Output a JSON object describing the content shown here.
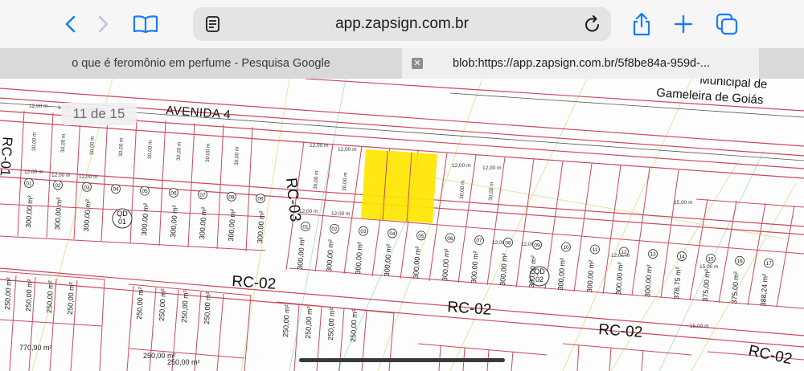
{
  "browser": {
    "url": "app.zapsign.com.br",
    "tabs": [
      {
        "title": "o que é feromônio em perfume - Pesquisa Google",
        "active": false
      },
      {
        "title": "blob:https://app.zapsign.com.br/5f8be84a-959d-...",
        "active": true
      }
    ],
    "accent_color": "#1a7cf5",
    "icons": {
      "back": "chevron-left-icon",
      "forward": "chevron-right-icon",
      "bookmarks": "book-icon",
      "reader": "reader-icon",
      "reload": "reload-icon",
      "share": "share-icon",
      "new_tab": "plus-icon",
      "tabs": "tabs-icon"
    }
  },
  "viewer": {
    "page_indicator": "11 de 15"
  },
  "map": {
    "street_labels": {
      "avenida": "AVENIDA 4",
      "rc01": "RC-01",
      "rc03": "RC-03",
      "rc02_a": "RC-02",
      "rc02_b": "RC-02",
      "rc02_c": "RC-02",
      "rc02_d": "RC-02"
    },
    "municipality": [
      "Municipal de",
      "Gameleira de Goiás"
    ],
    "blocks": {
      "qd01": [
        "QD",
        "01"
      ],
      "qd02": [
        "QD",
        "02"
      ]
    },
    "highlight_color": "#ffe600",
    "lot_dims": {
      "frontage": "12,00 m",
      "depth": "30,00 m",
      "side": "15,00 m"
    },
    "upper_lots": [
      {
        "num": "01",
        "area": "300,00 m²"
      },
      {
        "num": "02",
        "area": "300,00 m²"
      },
      {
        "num": "03",
        "area": "300,00 m²"
      },
      {
        "num": "04",
        "area": "300,00 m²"
      },
      {
        "num": "05",
        "area": "300,00 m²"
      },
      {
        "num": "06",
        "area": "300,00 m²"
      },
      {
        "num": "07",
        "area": "300,00 m²"
      },
      {
        "num": "08",
        "area": "300,00 m²"
      },
      {
        "num": "09",
        "area": "300,00 m²"
      }
    ],
    "mid_lots": [
      {
        "num": "01",
        "area": "300,00 m²"
      },
      {
        "num": "02",
        "area": "300,00 m²"
      },
      {
        "num": "03",
        "area": "300,00 m²"
      },
      {
        "num": "04",
        "area": "300,00 m²"
      },
      {
        "num": "05",
        "area": "300,00 m²"
      },
      {
        "num": "06",
        "area": "300,00 m²"
      },
      {
        "num": "07",
        "area": "300,00 m²"
      },
      {
        "num": "08",
        "area": "300,00 m²"
      },
      {
        "num": "09",
        "area": "300,00 m²"
      },
      {
        "num": "10",
        "area": "300,00 m²"
      },
      {
        "num": "11",
        "area": "300,00 m²"
      },
      {
        "num": "12",
        "area": "300,00 m²"
      },
      {
        "num": "13",
        "area": "300,00 m²"
      },
      {
        "num": "14",
        "area": "378,75 m²"
      },
      {
        "num": "15",
        "area": "375,00 m²"
      },
      {
        "num": "16",
        "area": "375,00 m²"
      },
      {
        "num": "17",
        "area": "388,24 m²"
      }
    ],
    "lower_lots": [
      {
        "area": "250,00 m²"
      },
      {
        "area": "250,00 m²"
      },
      {
        "area": "250,00 m²"
      },
      {
        "area": "250,00 m²"
      },
      {
        "area": "250,00 m²"
      },
      {
        "area": "250,00 m²"
      },
      {
        "area": "250,00 m²"
      },
      {
        "area": "250,00 m²"
      },
      {
        "area": "250,00 m²"
      },
      {
        "area": "250,00 m²"
      },
      {
        "area": "250,00 m²"
      },
      {
        "area": "250,00 m²"
      }
    ],
    "extra_areas": {
      "a": "770,90 m²",
      "b": "250,00 m²",
      "c": "250,00 m²"
    }
  }
}
